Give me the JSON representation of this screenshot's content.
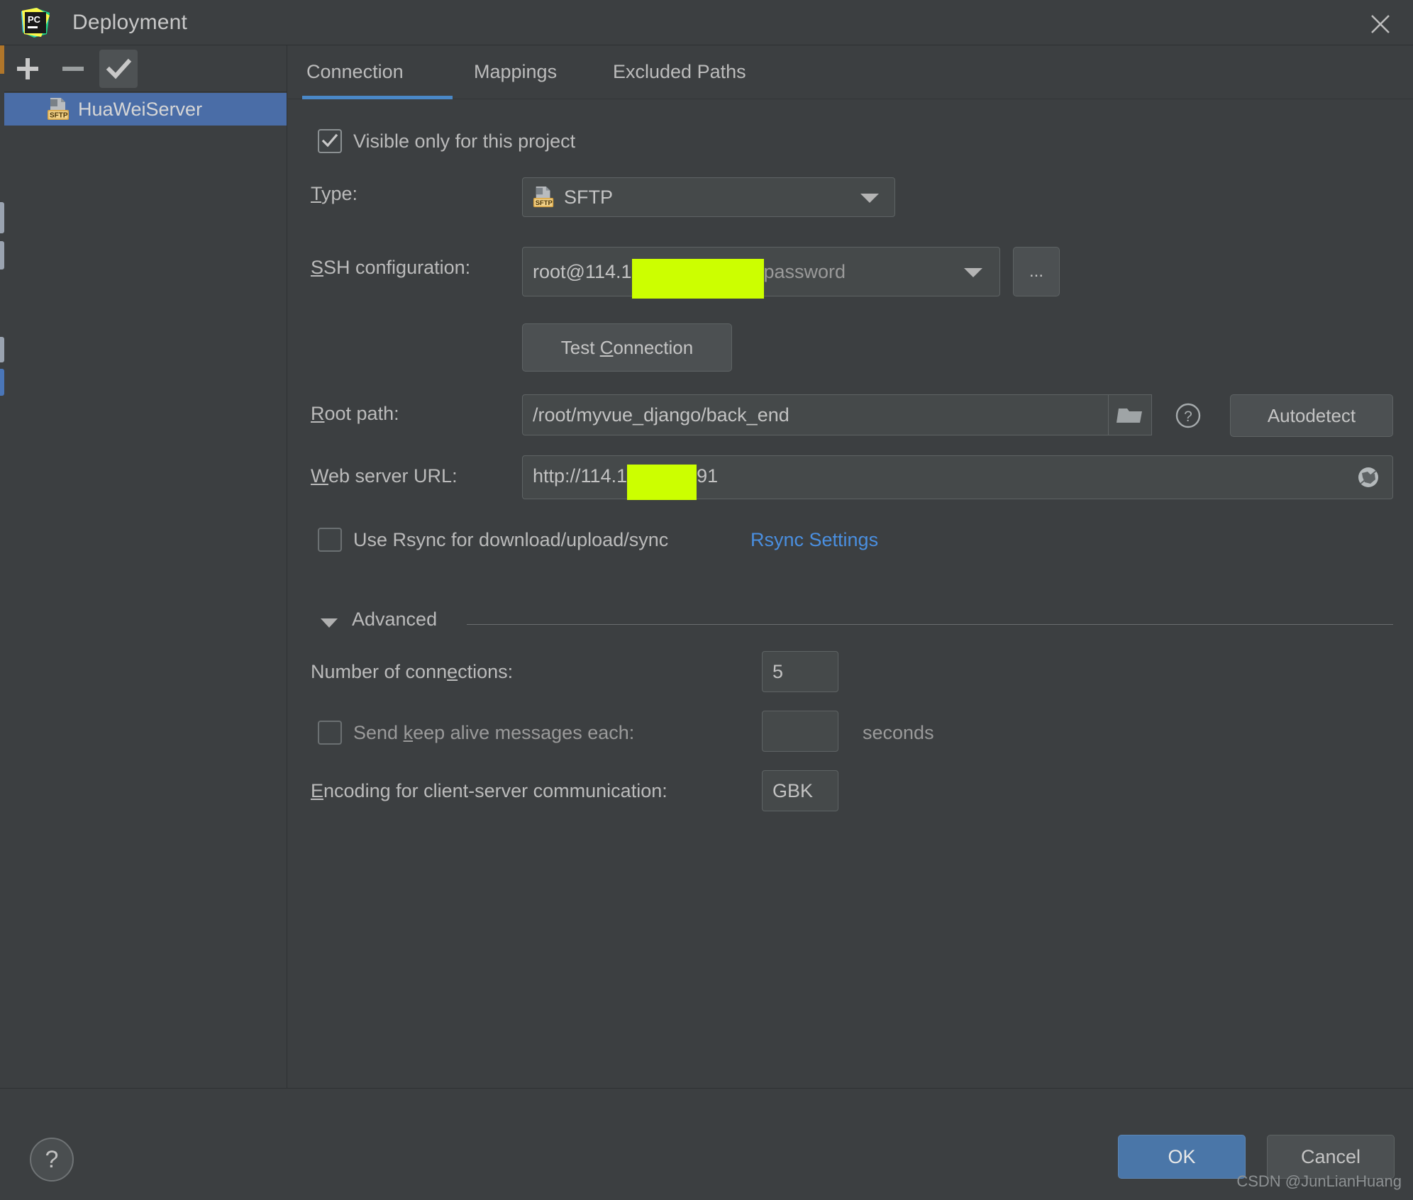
{
  "window": {
    "title": "Deployment",
    "app_icon": "pycharm-logo-icon",
    "close_icon": "close-icon"
  },
  "sidebar": {
    "toolbar": [
      {
        "name": "add-server-button",
        "icon": "plus-icon",
        "label": "+"
      },
      {
        "name": "remove-server-button",
        "icon": "minus-icon",
        "label": "−"
      },
      {
        "name": "set-default-server-button",
        "icon": "check-icon",
        "label": "✓"
      }
    ],
    "items": [
      {
        "label": "HuaWeiServer",
        "icon": "sftp-file-icon",
        "badge": "SFTP",
        "selected": true
      }
    ]
  },
  "tabs": [
    {
      "label": "Connection",
      "active": true
    },
    {
      "label": "Mappings",
      "active": false
    },
    {
      "label": "Excluded Paths",
      "active": false
    }
  ],
  "form": {
    "visible_only": {
      "label": "Visible only for this project",
      "checked": true
    },
    "type": {
      "label": "Type:",
      "mnemonic": "T",
      "value": "SFTP",
      "badge": "SFTP",
      "icon": "sftp-file-icon"
    },
    "ssh_configuration": {
      "label": "SSH configuration:",
      "mnemonic": "S",
      "value_prefix": "root@114.1",
      "value_suffix": "password",
      "redacted": true,
      "more_button": "..."
    },
    "test_connection": {
      "label": "Test Connection",
      "mnemonic": "C"
    },
    "root_path": {
      "label": "Root path:",
      "mnemonic": "R",
      "value": "/root/myvue_django/back_end",
      "browse_icon": "folder-icon",
      "help_icon": "question-circle-icon",
      "autodetect_label": "Autodetect"
    },
    "web_server_url": {
      "label": "Web server URL:",
      "mnemonic": "W",
      "value_prefix": "http://114.1",
      "value_suffix": "91",
      "redacted": true,
      "open_icon": "globe-icon"
    },
    "use_rsync": {
      "label": "Use Rsync for download/upload/sync",
      "checked": false,
      "link_label": "Rsync Settings"
    },
    "advanced": {
      "label": "Advanced",
      "expanded": true,
      "toggle_icon": "chevron-down-icon",
      "number_of_connections": {
        "label": "Number of connections:",
        "mnemonic": "e",
        "value": "5"
      },
      "keep_alive": {
        "label": "Send keep alive messages each:",
        "mnemonic": "k",
        "checked": false,
        "value": "",
        "unit": "seconds"
      },
      "encoding": {
        "label": "Encoding for client-server communication:",
        "mnemonic": "E",
        "value": "GBK"
      }
    }
  },
  "footer": {
    "help_icon": "question-circle-icon",
    "help_label": "?",
    "ok_label": "OK",
    "cancel_label": "Cancel",
    "watermark": "CSDN @JunLianHuang"
  },
  "colors": {
    "background": "#3c3f41",
    "selection": "#4a6da7",
    "accent": "#4a88c7",
    "link": "#4a8fe0",
    "redaction": "#ccff00",
    "ok_button": "#4a76a8"
  }
}
